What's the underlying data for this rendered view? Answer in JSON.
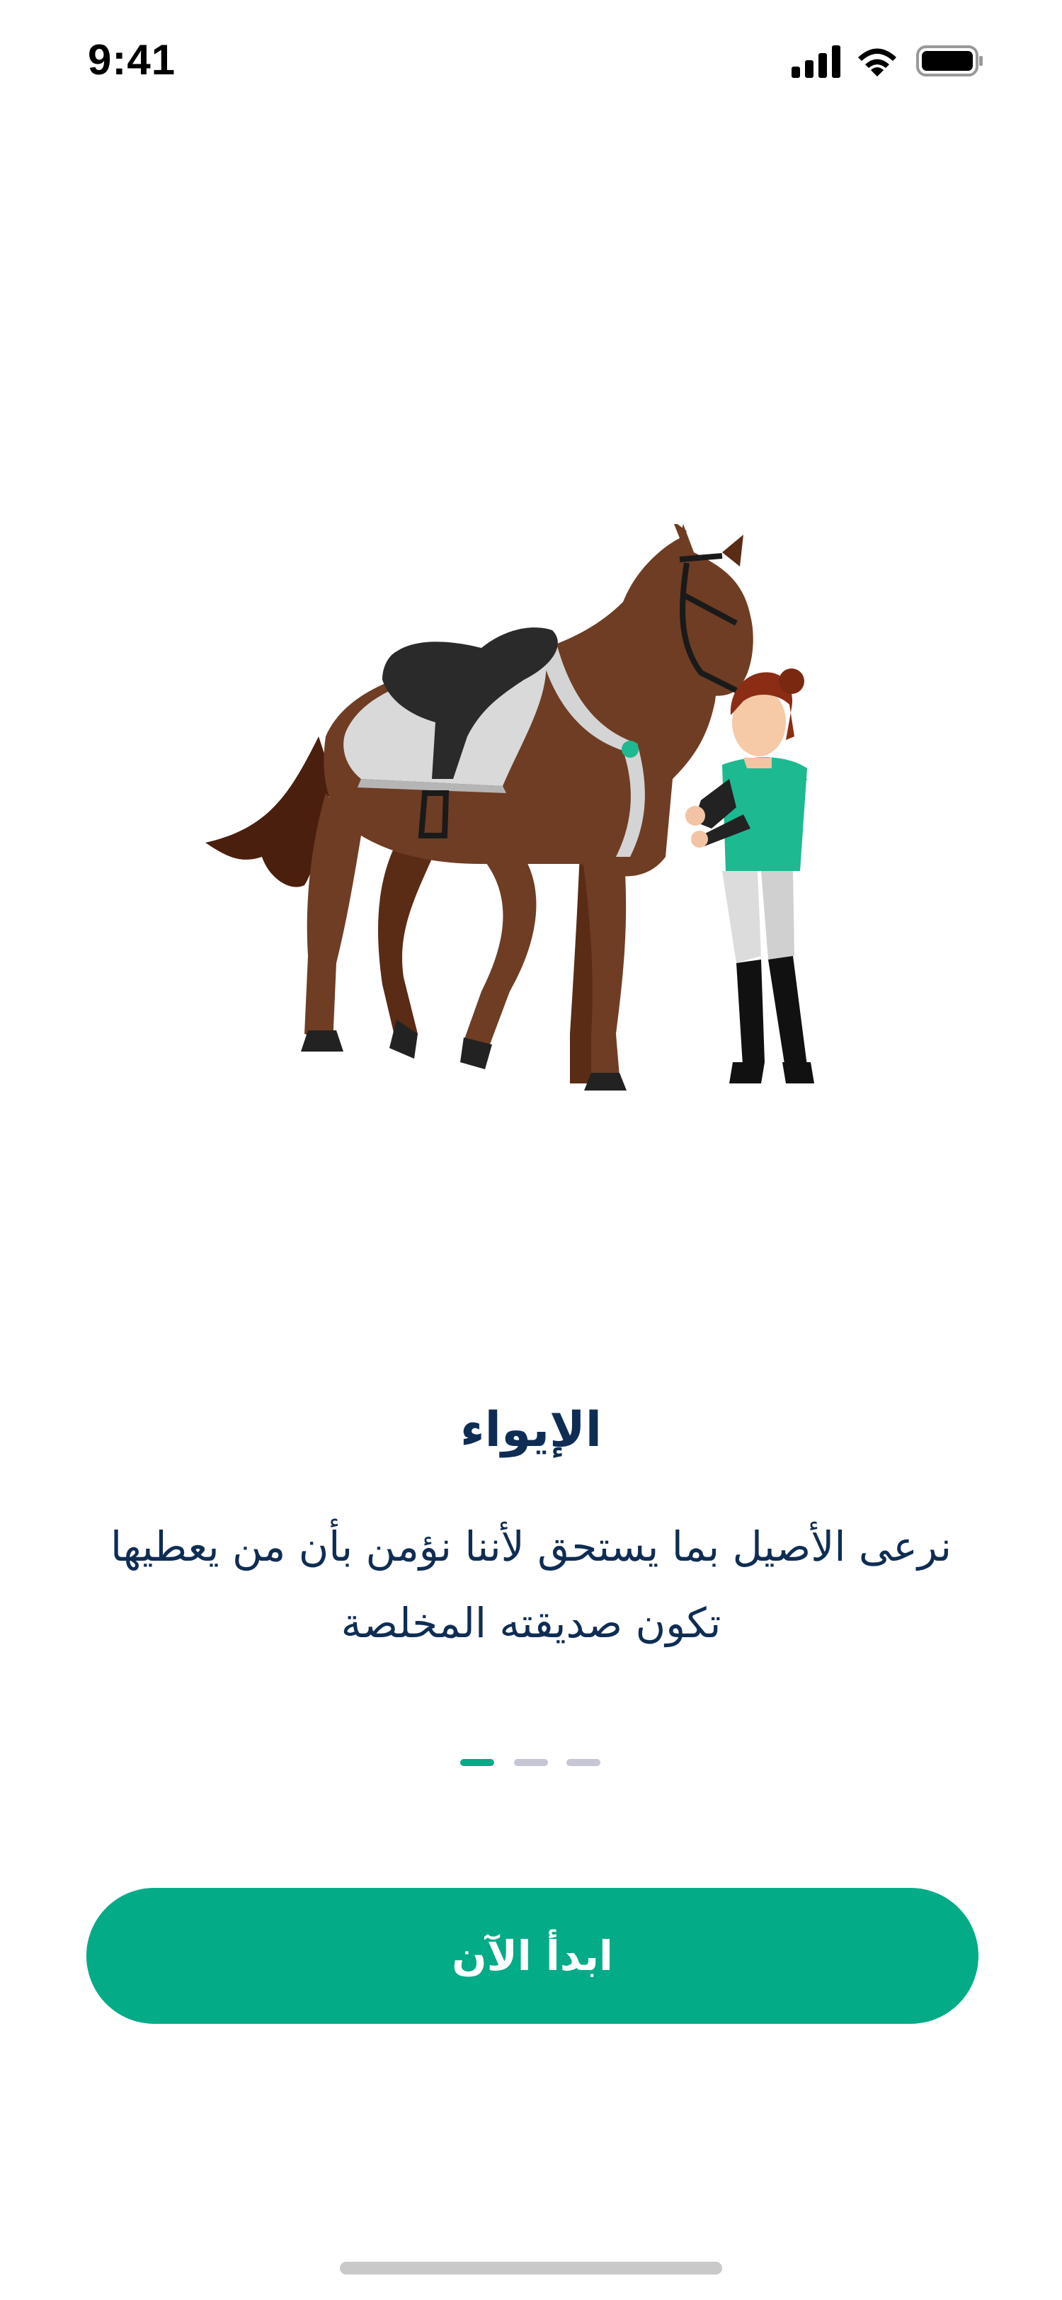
{
  "status_bar": {
    "time": "9:41",
    "icons": [
      "signal-icon",
      "wifi-icon",
      "battery-icon"
    ]
  },
  "onboarding": {
    "illustration": "horse-and-rider-illustration",
    "title": "الإيواء",
    "description": "نرعى الأصيل بما يستحق لأننا نؤمن بأن من يعطيها تكون صديقته المخلصة",
    "pager": {
      "total": 3,
      "active": 1
    },
    "start_button_label": "ابدأ الآن"
  },
  "colors": {
    "accent": "#03ab87",
    "title_text": "#0f2d54",
    "pager_active": "#03ab87",
    "pager_inactive": "#c7c6d4",
    "horse_body": "#6f3d24"
  }
}
